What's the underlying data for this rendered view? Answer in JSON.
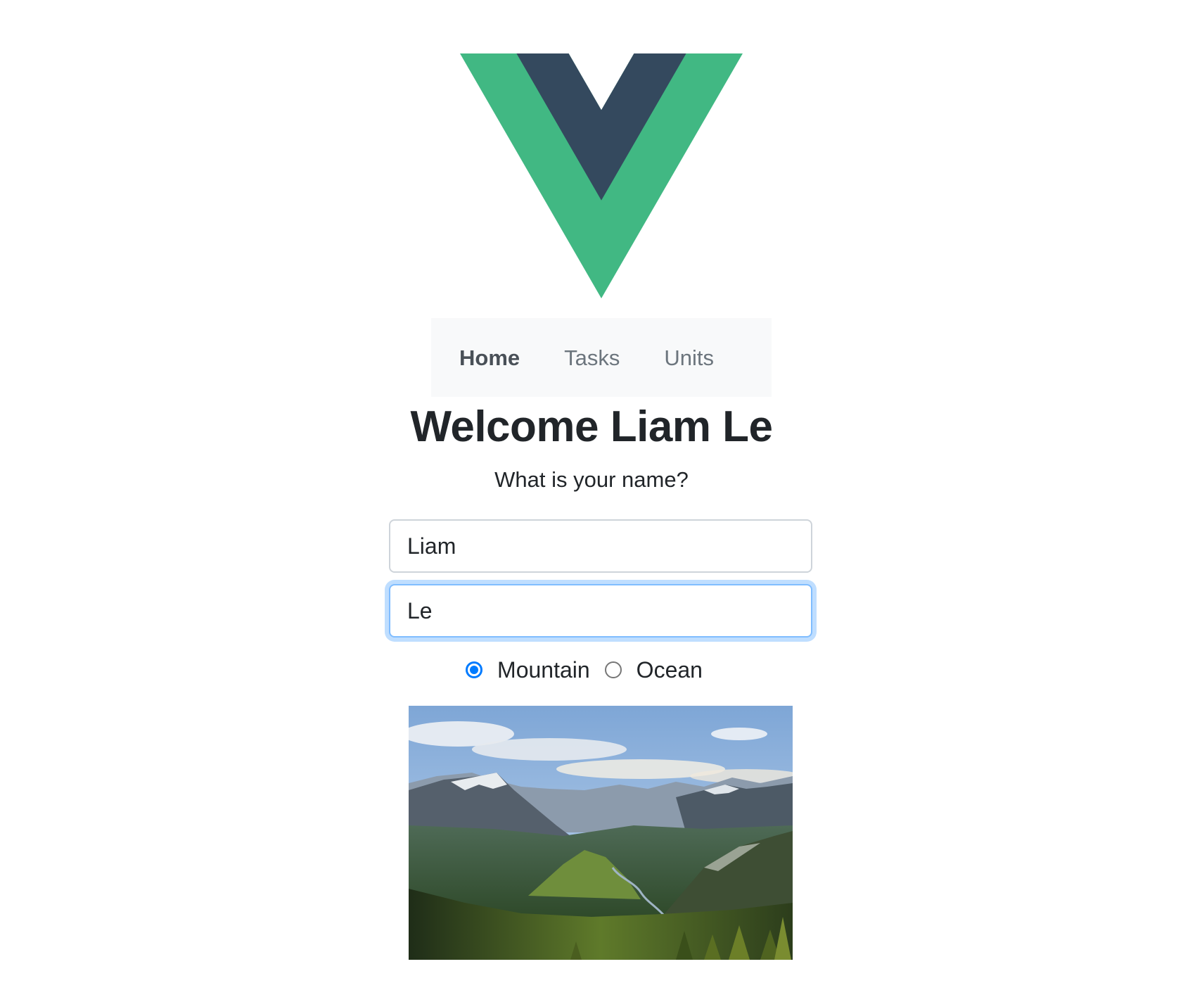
{
  "logo": {
    "name": "vue-logo",
    "outer_color": "#41b883",
    "inner_color": "#34495e"
  },
  "nav": {
    "items": [
      {
        "label": "Home",
        "active": true
      },
      {
        "label": "Tasks",
        "active": false
      },
      {
        "label": "Units",
        "active": false
      }
    ]
  },
  "welcome": {
    "title": "Welcome Liam Le"
  },
  "question": "What is your name?",
  "form": {
    "first_name": {
      "value": "Liam"
    },
    "last_name": {
      "value": "Le",
      "focused": true
    }
  },
  "scenery": {
    "options": [
      {
        "label": "Mountain",
        "checked": true
      },
      {
        "label": "Ocean",
        "checked": false
      }
    ],
    "image": "mountain-valley-landscape"
  },
  "colors": {
    "accent": "#007bff",
    "focus_ring": "#80bdff",
    "nav_background": "#f8f9fa"
  }
}
